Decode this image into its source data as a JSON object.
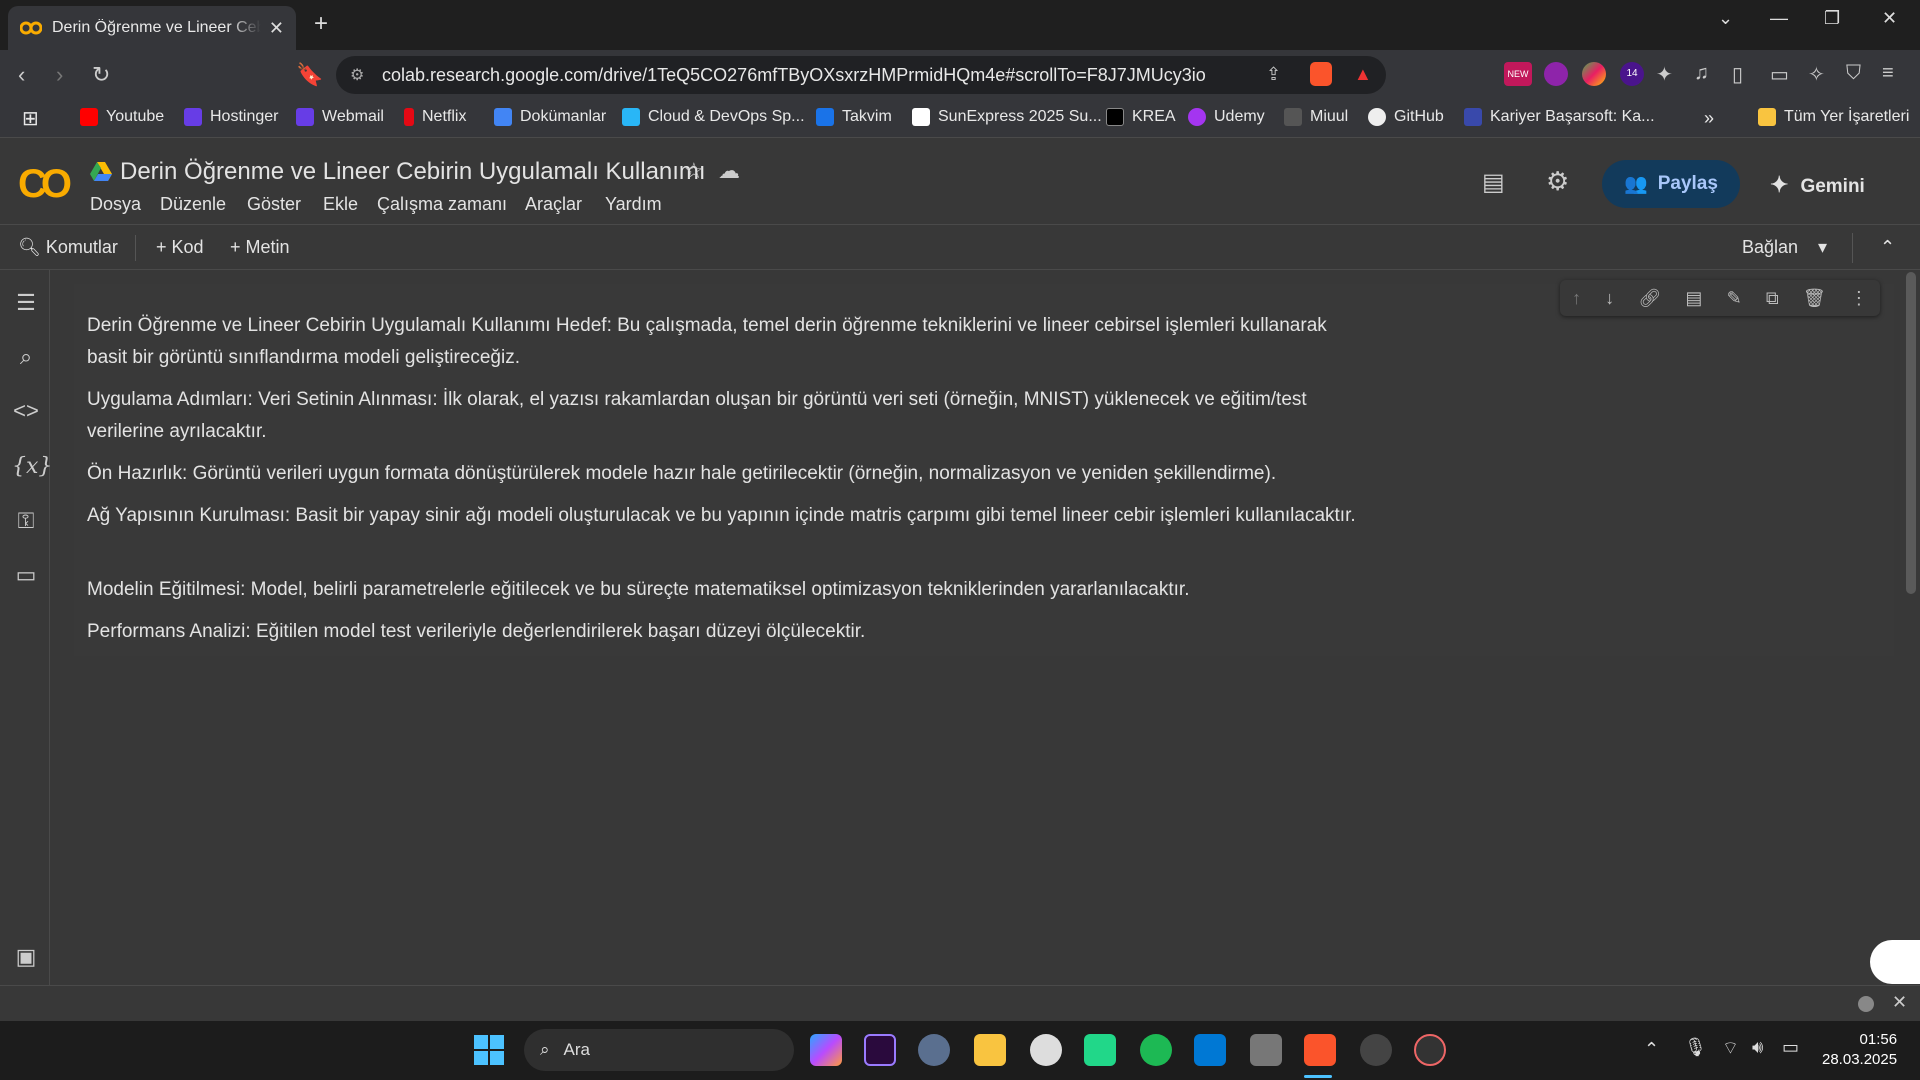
{
  "browser": {
    "tab_title": "Derin Öğrenme ve Lineer Cebirin Uygula",
    "address": "colab.research.google.com/drive/1TeQ5CO276mfTByOXsxrzHMPrmidHQm4e#scrollTo=F8J7JMUcy3io",
    "badge_new": "NEW",
    "badge_count": "14",
    "bookmarks": [
      "Youtube",
      "Hostinger",
      "Webmail",
      "Netflix",
      "Dokümanlar",
      "Cloud & DevOps Sp...",
      "Takvim",
      "SunExpress 2025 Su...",
      "KREA",
      "Udemy",
      "Miuul",
      "GitHub",
      "Kariyer Başarsoft: Ka..."
    ],
    "all_bookmarks": "Tüm Yer İşaretleri"
  },
  "colab": {
    "doc_title": "Derin Öğrenme ve Lineer Cebirin Uygulamalı Kullanımı",
    "menu": [
      "Dosya",
      "Düzenle",
      "Göster",
      "Ekle",
      "Çalışma zamanı",
      "Araçlar",
      "Yardım"
    ],
    "share_label": "Paylaş",
    "gemini_label": "Gemini",
    "toolbar": {
      "commands": "Komutlar",
      "code": "Kod",
      "text": "Metin",
      "connect": "Bağlan"
    }
  },
  "cell": {
    "paragraphs": [
      "Derin Öğrenme ve Lineer Cebirin Uygulamalı Kullanımı Hedef: Bu çalışmada, temel derin öğrenme tekniklerini ve lineer cebirsel işlemleri kullanarak basit bir görüntü sınıflandırma modeli geliştireceğiz.",
      "Uygulama Adımları: Veri Setinin Alınması: İlk olarak, el yazısı rakamlardan oluşan bir görüntü veri seti (örneğin, MNIST) yüklenecek ve eğitim/test verilerine ayrılacaktır.",
      "Ön Hazırlık: Görüntü verileri uygun formata dönüştürülerek modele hazır hale getirilecektir (örneğin, normalizasyon ve yeniden şekillendirme).",
      "Ağ Yapısının Kurulması: Basit bir yapay sinir ağı modeli oluşturulacak ve bu yapının içinde matris çarpımı gibi temel lineer cebir işlemleri kullanılacaktır.",
      "Modelin Eğitilmesi: Model, belirli parametrelerle eğitilecek ve bu süreçte matematiksel optimizasyon tekniklerinden yararlanılacaktır.",
      "Performans Analizi: Eğitilen model test verileriyle değerlendirilerek başarı düzeyi ölçülecektir."
    ]
  },
  "taskbar": {
    "search_label": "Ara",
    "time": "01:56",
    "date": "28.03.2025"
  },
  "colors": {
    "accent": "#f9ab00",
    "share_bg": "#123a5b",
    "share_fg": "#a8c7fa"
  }
}
